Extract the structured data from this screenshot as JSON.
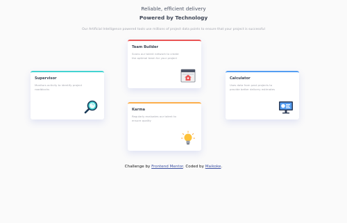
{
  "header": {
    "tagline": "Reliable, efficient delivery",
    "title": "Powered by Technology",
    "description": "Our Artificial Intelligence powered tools use millions of project data points to ensure that your project is successful"
  },
  "cards": [
    {
      "title": "Supervisor",
      "description": "Monitors activity to identify project roadblocks",
      "icon": "magnifier-icon",
      "accent": "#44d3d2"
    },
    {
      "title": "Team Builder",
      "description": "Scans our talent network to create the optimal team for your project",
      "icon": "team-builder-icon",
      "accent": "#ea5454"
    },
    {
      "title": "Karma",
      "description": "Regularly evaluates our talent to ensure quality",
      "icon": "lightbulb-icon",
      "accent": "#fcae4a"
    },
    {
      "title": "Calculator",
      "description": "Uses data from past projects to provide better delivery estimates",
      "icon": "monitor-calculator-icon",
      "accent": "#549ef2"
    }
  ],
  "footer": {
    "prefix": "Challenge by",
    "link1": "Frontend Mentor",
    "middle": ". Coded by",
    "link2": "Maikoke",
    "suffix": "."
  }
}
